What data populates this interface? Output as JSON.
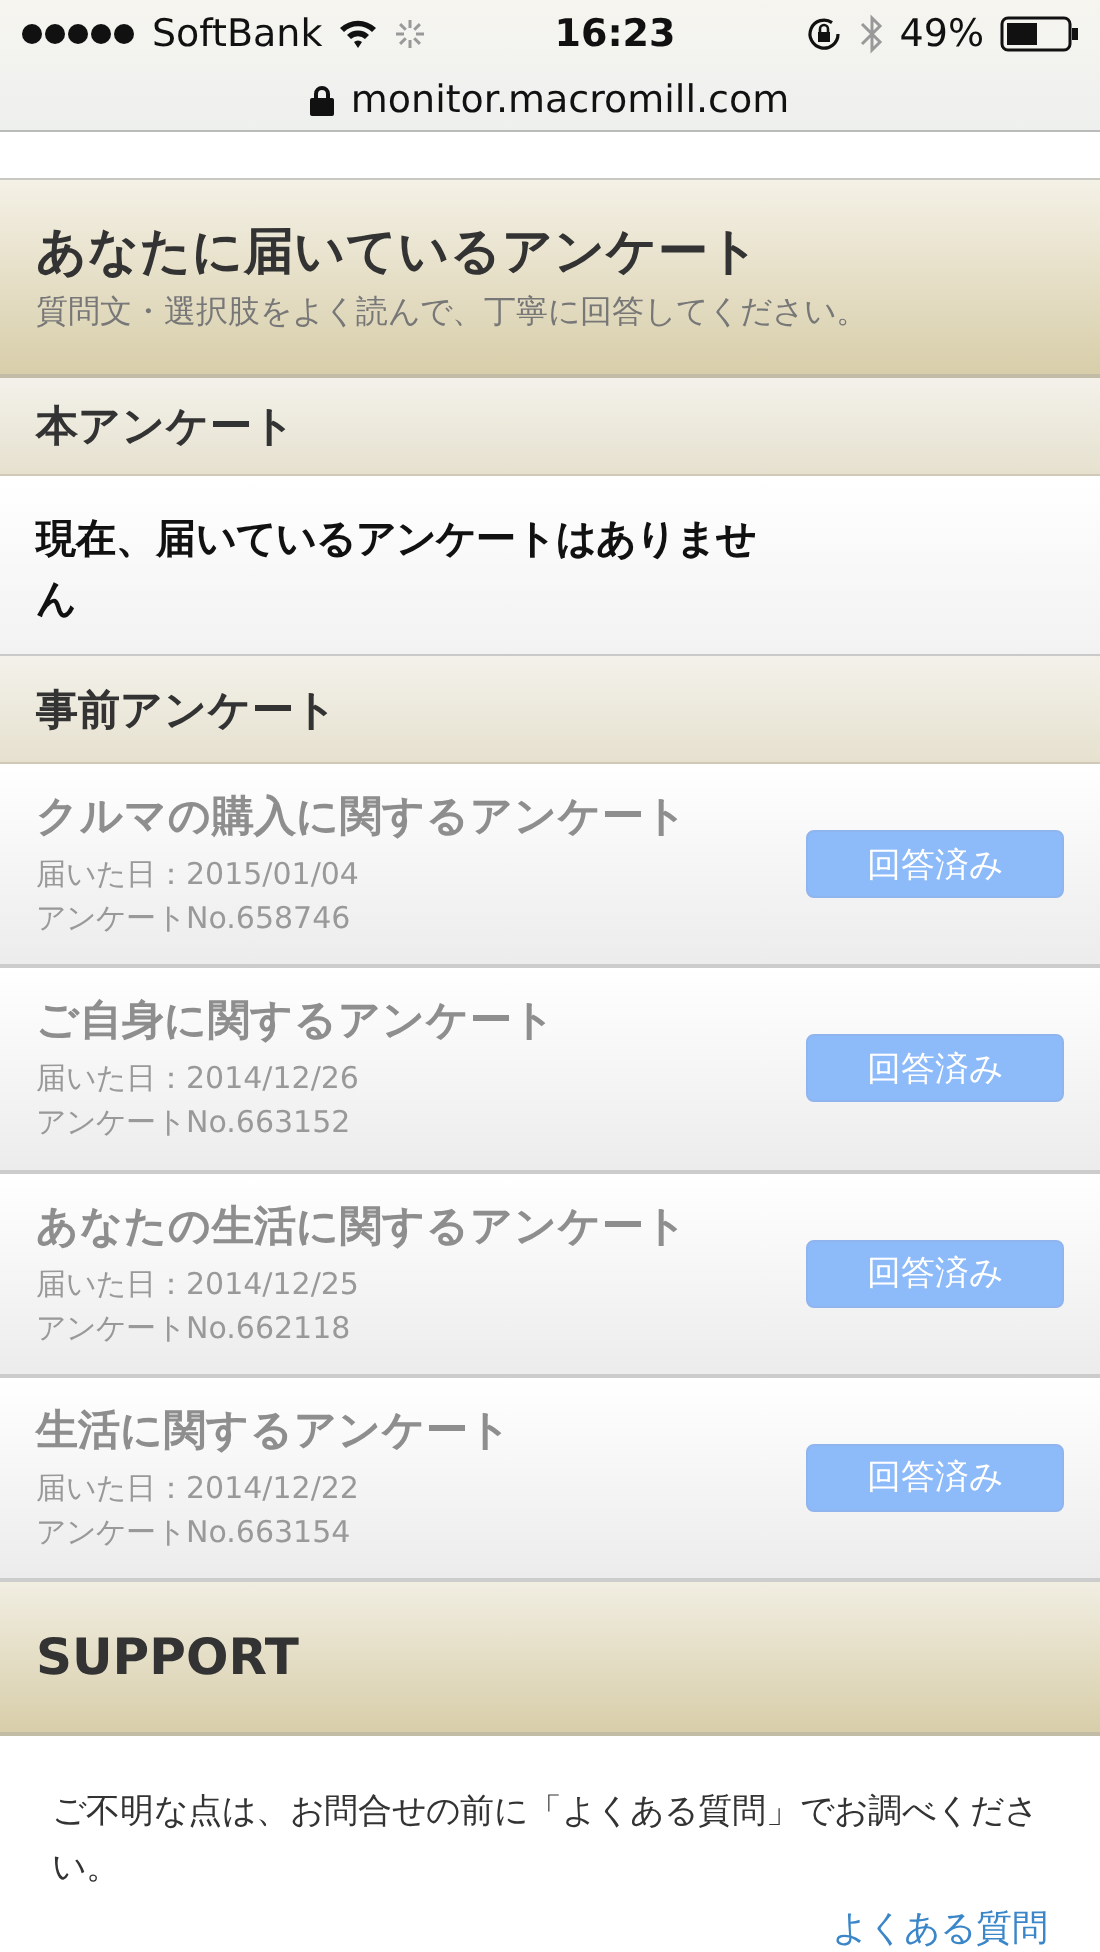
{
  "status_bar": {
    "carrier": "SoftBank",
    "time": "16:23",
    "battery": "49%"
  },
  "url_bar": {
    "url": "monitor.macromill.com"
  },
  "header": {
    "title": "あなたに届いているアンケート",
    "subtitle": "質問文・選択肢をよく読んで、丁寧に回答してください。"
  },
  "main_survey": {
    "heading": "本アンケート",
    "message": "現在、届いているアンケートはありません"
  },
  "pre_survey": {
    "heading": "事前アンケート",
    "items": [
      {
        "title": "クルマの購入に関するアンケート",
        "date": "届いた日：2015/01/04",
        "number": "アンケートNo.658746",
        "button": "回答済み",
        "answered": true
      },
      {
        "title": "ご自身に関するアンケート",
        "date": "届いた日：2014/12/26",
        "number": "アンケートNo.663152",
        "button": "回答済み",
        "answered": true
      },
      {
        "title": "あなたの生活に関するアンケート",
        "date": "届いた日：2014/12/25",
        "number": "アンケートNo.662118",
        "button": "回答済み",
        "answered": true
      },
      {
        "title": "生活に関するアンケート",
        "date": "届いた日：2014/12/22",
        "number": "アンケートNo.663154",
        "button": "回答済み",
        "answered": true
      }
    ]
  },
  "support": {
    "heading": "SUPPORT",
    "text": "ご不明な点は、お問合せの前に「よくある質問」でお調べください。",
    "link": "よくある質問"
  }
}
